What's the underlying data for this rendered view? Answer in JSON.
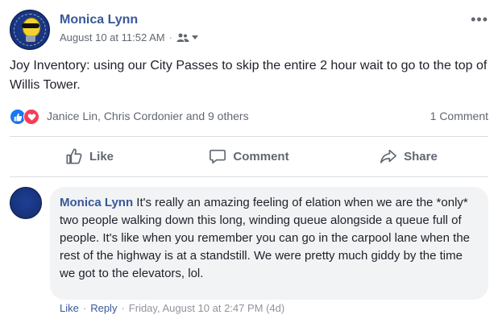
{
  "post": {
    "author": "Monica Lynn",
    "timestamp": "August 10 at 11:52 AM",
    "separator": "·",
    "audience_icon": "friends-icon",
    "text": "Joy Inventory: using our City Passes to skip the entire 2 hour wait to go to the top of Willis Tower."
  },
  "reactions": {
    "types": [
      "like",
      "love"
    ],
    "summary": "Janice Lin, Chris Cordonier and 9 others",
    "comment_count": "1 Comment"
  },
  "actions": [
    {
      "label": "Like",
      "icon": "thumbs-up-icon"
    },
    {
      "label": "Comment",
      "icon": "speech-bubble-icon"
    },
    {
      "label": "Share",
      "icon": "share-arrow-icon"
    }
  ],
  "comment": {
    "author": "Monica Lynn",
    "text": "It's really an amazing feeling of elation when we are the *only* two people walking down this long, winding queue alongside a queue full of people. It's like when you remember you can go in the carpool lane when the rest of the highway is at a standstill. We were pretty much giddy by the time we got to the elevators, lol.",
    "like_label": "Like",
    "reply_label": "Reply",
    "separator": "·",
    "timestamp": "Friday, August 10 at 2:47 PM (4d)"
  },
  "colors": {
    "link": "#385898",
    "like_blue": "#1877f2",
    "love_red": "#f33e58",
    "muted": "#606770"
  }
}
